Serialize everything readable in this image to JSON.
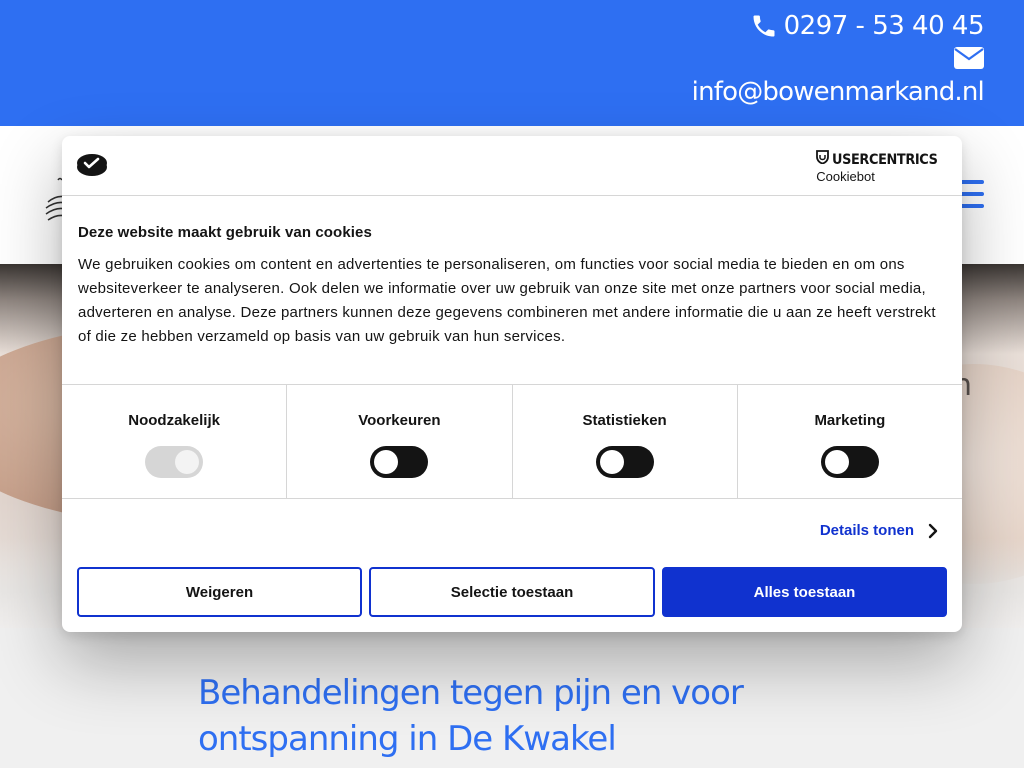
{
  "contact": {
    "phone": "0297 - 53 40 45",
    "email": "info@bowenmarkand.nl"
  },
  "icons": {
    "phone": "phone-icon",
    "mail": "envelope-icon",
    "menu": "hamburger-menu-icon",
    "cookie": "cookie-icon",
    "shield": "usercentrics-shield-icon",
    "chevron": "chevron-right-icon"
  },
  "colors": {
    "brand_blue": "#2e6ff2",
    "dialog_accent": "#1032cf",
    "text_dark": "#141414"
  },
  "hero": {
    "peek_text": "n"
  },
  "headline": {
    "line1": "Behandelingen tegen pijn en voor",
    "line2": "ontspanning in De Kwakel"
  },
  "dialog": {
    "brand_name": "USERCENTRICS",
    "brand_sub": "Cookiebot",
    "title": "Deze website maakt gebruik van cookies",
    "body": "We gebruiken cookies om content en advertenties te personaliseren, om functies voor social media te bieden en om ons websiteverkeer te analyseren. Ook delen we informatie over uw gebruik van onze site met onze partners voor social media, adverteren en analyse. Deze partners kunnen deze gegevens combineren met andere informatie die u aan ze heeft verstrekt of die ze hebben verzameld op basis van uw gebruik van hun services.",
    "categories": [
      {
        "label": "Noodzakelijk",
        "enabled": true,
        "locked": true
      },
      {
        "label": "Voorkeuren",
        "enabled": false,
        "locked": false
      },
      {
        "label": "Statistieken",
        "enabled": false,
        "locked": false
      },
      {
        "label": "Marketing",
        "enabled": false,
        "locked": false
      }
    ],
    "details_label": "Details tonen",
    "buttons": {
      "reject": "Weigeren",
      "selection": "Selectie toestaan",
      "accept_all": "Alles toestaan"
    }
  }
}
